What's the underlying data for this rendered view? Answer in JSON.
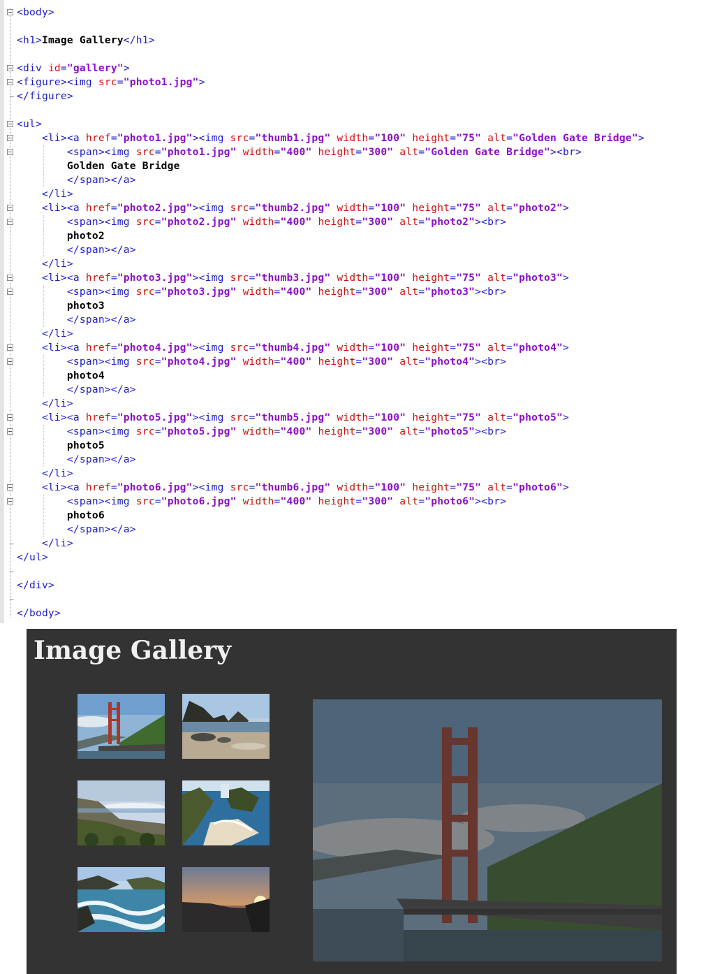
{
  "code_lines": [
    {
      "segs": [
        [
          "t",
          "<body>"
        ]
      ]
    },
    {
      "segs": []
    },
    {
      "segs": [
        [
          "t",
          "<h1>"
        ],
        [
          "x",
          "Image Gallery"
        ],
        [
          "t",
          "</h1>"
        ]
      ]
    },
    {
      "segs": []
    },
    {
      "segs": [
        [
          "t",
          "<div "
        ],
        [
          "a",
          "id"
        ],
        [
          "t",
          "="
        ],
        [
          "v",
          "\"gallery\""
        ],
        [
          "t",
          ">"
        ]
      ]
    },
    {
      "segs": [
        [
          "t",
          "<figure><img "
        ],
        [
          "a",
          "src"
        ],
        [
          "t",
          "="
        ],
        [
          "v",
          "\"photo1.jpg\""
        ],
        [
          "t",
          ">"
        ]
      ]
    },
    {
      "segs": [
        [
          "t",
          "</figure>"
        ]
      ]
    },
    {
      "segs": []
    },
    {
      "segs": [
        [
          "t",
          "<ul>"
        ]
      ]
    },
    {
      "segs": [
        [
          "t",
          "    <li><a "
        ],
        [
          "a",
          "href"
        ],
        [
          "t",
          "="
        ],
        [
          "v",
          "\"photo1.jpg\""
        ],
        [
          "t",
          "><img "
        ],
        [
          "a",
          "src"
        ],
        [
          "t",
          "="
        ],
        [
          "v",
          "\"thumb1.jpg\""
        ],
        [
          "t",
          " "
        ],
        [
          "a",
          "width"
        ],
        [
          "t",
          "="
        ],
        [
          "v",
          "\"100\""
        ],
        [
          "t",
          " "
        ],
        [
          "a",
          "height"
        ],
        [
          "t",
          "="
        ],
        [
          "v",
          "\"75\""
        ],
        [
          "t",
          " "
        ],
        [
          "a",
          "alt"
        ],
        [
          "t",
          "="
        ],
        [
          "v",
          "\"Golden Gate Bridge\""
        ],
        [
          "t",
          ">"
        ]
      ]
    },
    {
      "segs": [
        [
          "t",
          "        <span><img "
        ],
        [
          "a",
          "src"
        ],
        [
          "t",
          "="
        ],
        [
          "v",
          "\"photo1.jpg\""
        ],
        [
          "t",
          " "
        ],
        [
          "a",
          "width"
        ],
        [
          "t",
          "="
        ],
        [
          "v",
          "\"400\""
        ],
        [
          "t",
          " "
        ],
        [
          "a",
          "height"
        ],
        [
          "t",
          "="
        ],
        [
          "v",
          "\"300\""
        ],
        [
          "t",
          " "
        ],
        [
          "a",
          "alt"
        ],
        [
          "t",
          "="
        ],
        [
          "v",
          "\"Golden Gate Bridge\""
        ],
        [
          "t",
          "><br>"
        ]
      ]
    },
    {
      "segs": [
        [
          "x",
          "        Golden Gate Bridge"
        ]
      ]
    },
    {
      "segs": [
        [
          "t",
          "        </span></a>"
        ]
      ]
    },
    {
      "segs": [
        [
          "t",
          "    </li>"
        ]
      ]
    },
    {
      "segs": [
        [
          "t",
          "    <li><a "
        ],
        [
          "a",
          "href"
        ],
        [
          "t",
          "="
        ],
        [
          "v",
          "\"photo2.jpg\""
        ],
        [
          "t",
          "><img "
        ],
        [
          "a",
          "src"
        ],
        [
          "t",
          "="
        ],
        [
          "v",
          "\"thumb2.jpg\""
        ],
        [
          "t",
          " "
        ],
        [
          "a",
          "width"
        ],
        [
          "t",
          "="
        ],
        [
          "v",
          "\"100\""
        ],
        [
          "t",
          " "
        ],
        [
          "a",
          "height"
        ],
        [
          "t",
          "="
        ],
        [
          "v",
          "\"75\""
        ],
        [
          "t",
          " "
        ],
        [
          "a",
          "alt"
        ],
        [
          "t",
          "="
        ],
        [
          "v",
          "\"photo2\""
        ],
        [
          "t",
          ">"
        ]
      ]
    },
    {
      "segs": [
        [
          "t",
          "        <span><img "
        ],
        [
          "a",
          "src"
        ],
        [
          "t",
          "="
        ],
        [
          "v",
          "\"photo2.jpg\""
        ],
        [
          "t",
          " "
        ],
        [
          "a",
          "width"
        ],
        [
          "t",
          "="
        ],
        [
          "v",
          "\"400\""
        ],
        [
          "t",
          " "
        ],
        [
          "a",
          "height"
        ],
        [
          "t",
          "="
        ],
        [
          "v",
          "\"300\""
        ],
        [
          "t",
          " "
        ],
        [
          "a",
          "alt"
        ],
        [
          "t",
          "="
        ],
        [
          "v",
          "\"photo2\""
        ],
        [
          "t",
          "><br>"
        ]
      ]
    },
    {
      "segs": [
        [
          "x",
          "        photo2"
        ]
      ]
    },
    {
      "segs": [
        [
          "t",
          "        </span></a>"
        ]
      ]
    },
    {
      "segs": [
        [
          "t",
          "    </li>"
        ]
      ]
    },
    {
      "segs": [
        [
          "t",
          "    <li><a "
        ],
        [
          "a",
          "href"
        ],
        [
          "t",
          "="
        ],
        [
          "v",
          "\"photo3.jpg\""
        ],
        [
          "t",
          "><img "
        ],
        [
          "a",
          "src"
        ],
        [
          "t",
          "="
        ],
        [
          "v",
          "\"thumb3.jpg\""
        ],
        [
          "t",
          " "
        ],
        [
          "a",
          "width"
        ],
        [
          "t",
          "="
        ],
        [
          "v",
          "\"100\""
        ],
        [
          "t",
          " "
        ],
        [
          "a",
          "height"
        ],
        [
          "t",
          "="
        ],
        [
          "v",
          "\"75\""
        ],
        [
          "t",
          " "
        ],
        [
          "a",
          "alt"
        ],
        [
          "t",
          "="
        ],
        [
          "v",
          "\"photo3\""
        ],
        [
          "t",
          ">"
        ]
      ]
    },
    {
      "segs": [
        [
          "t",
          "        <span><img "
        ],
        [
          "a",
          "src"
        ],
        [
          "t",
          "="
        ],
        [
          "v",
          "\"photo3.jpg\""
        ],
        [
          "t",
          " "
        ],
        [
          "a",
          "width"
        ],
        [
          "t",
          "="
        ],
        [
          "v",
          "\"400\""
        ],
        [
          "t",
          " "
        ],
        [
          "a",
          "height"
        ],
        [
          "t",
          "="
        ],
        [
          "v",
          "\"300\""
        ],
        [
          "t",
          " "
        ],
        [
          "a",
          "alt"
        ],
        [
          "t",
          "="
        ],
        [
          "v",
          "\"photo3\""
        ],
        [
          "t",
          "><br>"
        ]
      ]
    },
    {
      "segs": [
        [
          "x",
          "        photo3"
        ]
      ]
    },
    {
      "segs": [
        [
          "t",
          "        </span></a>"
        ]
      ]
    },
    {
      "segs": [
        [
          "t",
          "    </li>"
        ]
      ]
    },
    {
      "segs": [
        [
          "t",
          "    <li><a "
        ],
        [
          "a",
          "href"
        ],
        [
          "t",
          "="
        ],
        [
          "v",
          "\"photo4.jpg\""
        ],
        [
          "t",
          "><img "
        ],
        [
          "a",
          "src"
        ],
        [
          "t",
          "="
        ],
        [
          "v",
          "\"thumb4.jpg\""
        ],
        [
          "t",
          " "
        ],
        [
          "a",
          "width"
        ],
        [
          "t",
          "="
        ],
        [
          "v",
          "\"100\""
        ],
        [
          "t",
          " "
        ],
        [
          "a",
          "height"
        ],
        [
          "t",
          "="
        ],
        [
          "v",
          "\"75\""
        ],
        [
          "t",
          " "
        ],
        [
          "a",
          "alt"
        ],
        [
          "t",
          "="
        ],
        [
          "v",
          "\"photo4\""
        ],
        [
          "t",
          ">"
        ]
      ]
    },
    {
      "segs": [
        [
          "t",
          "        <span><img "
        ],
        [
          "a",
          "src"
        ],
        [
          "t",
          "="
        ],
        [
          "v",
          "\"photo4.jpg\""
        ],
        [
          "t",
          " "
        ],
        [
          "a",
          "width"
        ],
        [
          "t",
          "="
        ],
        [
          "v",
          "\"400\""
        ],
        [
          "t",
          " "
        ],
        [
          "a",
          "height"
        ],
        [
          "t",
          "="
        ],
        [
          "v",
          "\"300\""
        ],
        [
          "t",
          " "
        ],
        [
          "a",
          "alt"
        ],
        [
          "t",
          "="
        ],
        [
          "v",
          "\"photo4\""
        ],
        [
          "t",
          "><br>"
        ]
      ]
    },
    {
      "segs": [
        [
          "x",
          "        photo4"
        ]
      ]
    },
    {
      "segs": [
        [
          "t",
          "        </span></a>"
        ]
      ]
    },
    {
      "segs": [
        [
          "t",
          "    </li>"
        ]
      ]
    },
    {
      "segs": [
        [
          "t",
          "    <li><a "
        ],
        [
          "a",
          "href"
        ],
        [
          "t",
          "="
        ],
        [
          "v",
          "\"photo5.jpg\""
        ],
        [
          "t",
          "><img "
        ],
        [
          "a",
          "src"
        ],
        [
          "t",
          "="
        ],
        [
          "v",
          "\"thumb5.jpg\""
        ],
        [
          "t",
          " "
        ],
        [
          "a",
          "width"
        ],
        [
          "t",
          "="
        ],
        [
          "v",
          "\"100\""
        ],
        [
          "t",
          " "
        ],
        [
          "a",
          "height"
        ],
        [
          "t",
          "="
        ],
        [
          "v",
          "\"75\""
        ],
        [
          "t",
          " "
        ],
        [
          "a",
          "alt"
        ],
        [
          "t",
          "="
        ],
        [
          "v",
          "\"photo5\""
        ],
        [
          "t",
          ">"
        ]
      ]
    },
    {
      "segs": [
        [
          "t",
          "        <span><img "
        ],
        [
          "a",
          "src"
        ],
        [
          "t",
          "="
        ],
        [
          "v",
          "\"photo5.jpg\""
        ],
        [
          "t",
          " "
        ],
        [
          "a",
          "width"
        ],
        [
          "t",
          "="
        ],
        [
          "v",
          "\"400\""
        ],
        [
          "t",
          " "
        ],
        [
          "a",
          "height"
        ],
        [
          "t",
          "="
        ],
        [
          "v",
          "\"300\""
        ],
        [
          "t",
          " "
        ],
        [
          "a",
          "alt"
        ],
        [
          "t",
          "="
        ],
        [
          "v",
          "\"photo5\""
        ],
        [
          "t",
          "><br>"
        ]
      ]
    },
    {
      "segs": [
        [
          "x",
          "        photo5"
        ]
      ]
    },
    {
      "segs": [
        [
          "t",
          "        </span></a>"
        ]
      ]
    },
    {
      "segs": [
        [
          "t",
          "    </li>"
        ]
      ]
    },
    {
      "segs": [
        [
          "t",
          "    <li><a "
        ],
        [
          "a",
          "href"
        ],
        [
          "t",
          "="
        ],
        [
          "v",
          "\"photo6.jpg\""
        ],
        [
          "t",
          "><img "
        ],
        [
          "a",
          "src"
        ],
        [
          "t",
          "="
        ],
        [
          "v",
          "\"thumb6.jpg\""
        ],
        [
          "t",
          " "
        ],
        [
          "a",
          "width"
        ],
        [
          "t",
          "="
        ],
        [
          "v",
          "\"100\""
        ],
        [
          "t",
          " "
        ],
        [
          "a",
          "height"
        ],
        [
          "t",
          "="
        ],
        [
          "v",
          "\"75\""
        ],
        [
          "t",
          " "
        ],
        [
          "a",
          "alt"
        ],
        [
          "t",
          "="
        ],
        [
          "v",
          "\"photo6\""
        ],
        [
          "t",
          ">"
        ]
      ]
    },
    {
      "segs": [
        [
          "t",
          "        <span><img "
        ],
        [
          "a",
          "src"
        ],
        [
          "t",
          "="
        ],
        [
          "v",
          "\"photo6.jpg\""
        ],
        [
          "t",
          " "
        ],
        [
          "a",
          "width"
        ],
        [
          "t",
          "="
        ],
        [
          "v",
          "\"400\""
        ],
        [
          "t",
          " "
        ],
        [
          "a",
          "height"
        ],
        [
          "t",
          "="
        ],
        [
          "v",
          "\"300\""
        ],
        [
          "t",
          " "
        ],
        [
          "a",
          "alt"
        ],
        [
          "t",
          "="
        ],
        [
          "v",
          "\"photo6\""
        ],
        [
          "t",
          "><br>"
        ]
      ]
    },
    {
      "segs": [
        [
          "x",
          "        photo6"
        ]
      ]
    },
    {
      "segs": [
        [
          "t",
          "        </span></a>"
        ]
      ]
    },
    {
      "segs": [
        [
          "t",
          "    </li>"
        ]
      ]
    },
    {
      "segs": [
        [
          "t",
          "</ul>"
        ]
      ]
    },
    {
      "segs": []
    },
    {
      "segs": [
        [
          "t",
          "</div>"
        ]
      ]
    },
    {
      "segs": []
    },
    {
      "segs": [
        [
          "t",
          "</body>"
        ]
      ]
    }
  ],
  "fold_open_lines": [
    0,
    4,
    5,
    8,
    9,
    10,
    14,
    15,
    19,
    20,
    24,
    25,
    29,
    30,
    34,
    35
  ],
  "fold_end_lines": [
    6,
    38,
    40,
    42
  ],
  "colors": {
    "tag": "#1c1cc8",
    "attr_name": "#d01010",
    "attr_value": "#8b0fc8",
    "text": "#000000",
    "preview_bg": "#333333",
    "heading": "#f0f0f0"
  },
  "preview": {
    "heading": "Image Gallery",
    "thumbnails": [
      {
        "alt": "Golden Gate Bridge",
        "scene": "bridge"
      },
      {
        "alt": "photo2",
        "scene": "rocky-beach"
      },
      {
        "alt": "photo3",
        "scene": "coast-hills"
      },
      {
        "alt": "photo4",
        "scene": "cove"
      },
      {
        "alt": "photo5",
        "scene": "waves"
      },
      {
        "alt": "photo6",
        "scene": "sunset"
      }
    ],
    "main_image": {
      "alt": "Golden Gate Bridge",
      "scene": "bridge",
      "dimmed": true
    }
  }
}
